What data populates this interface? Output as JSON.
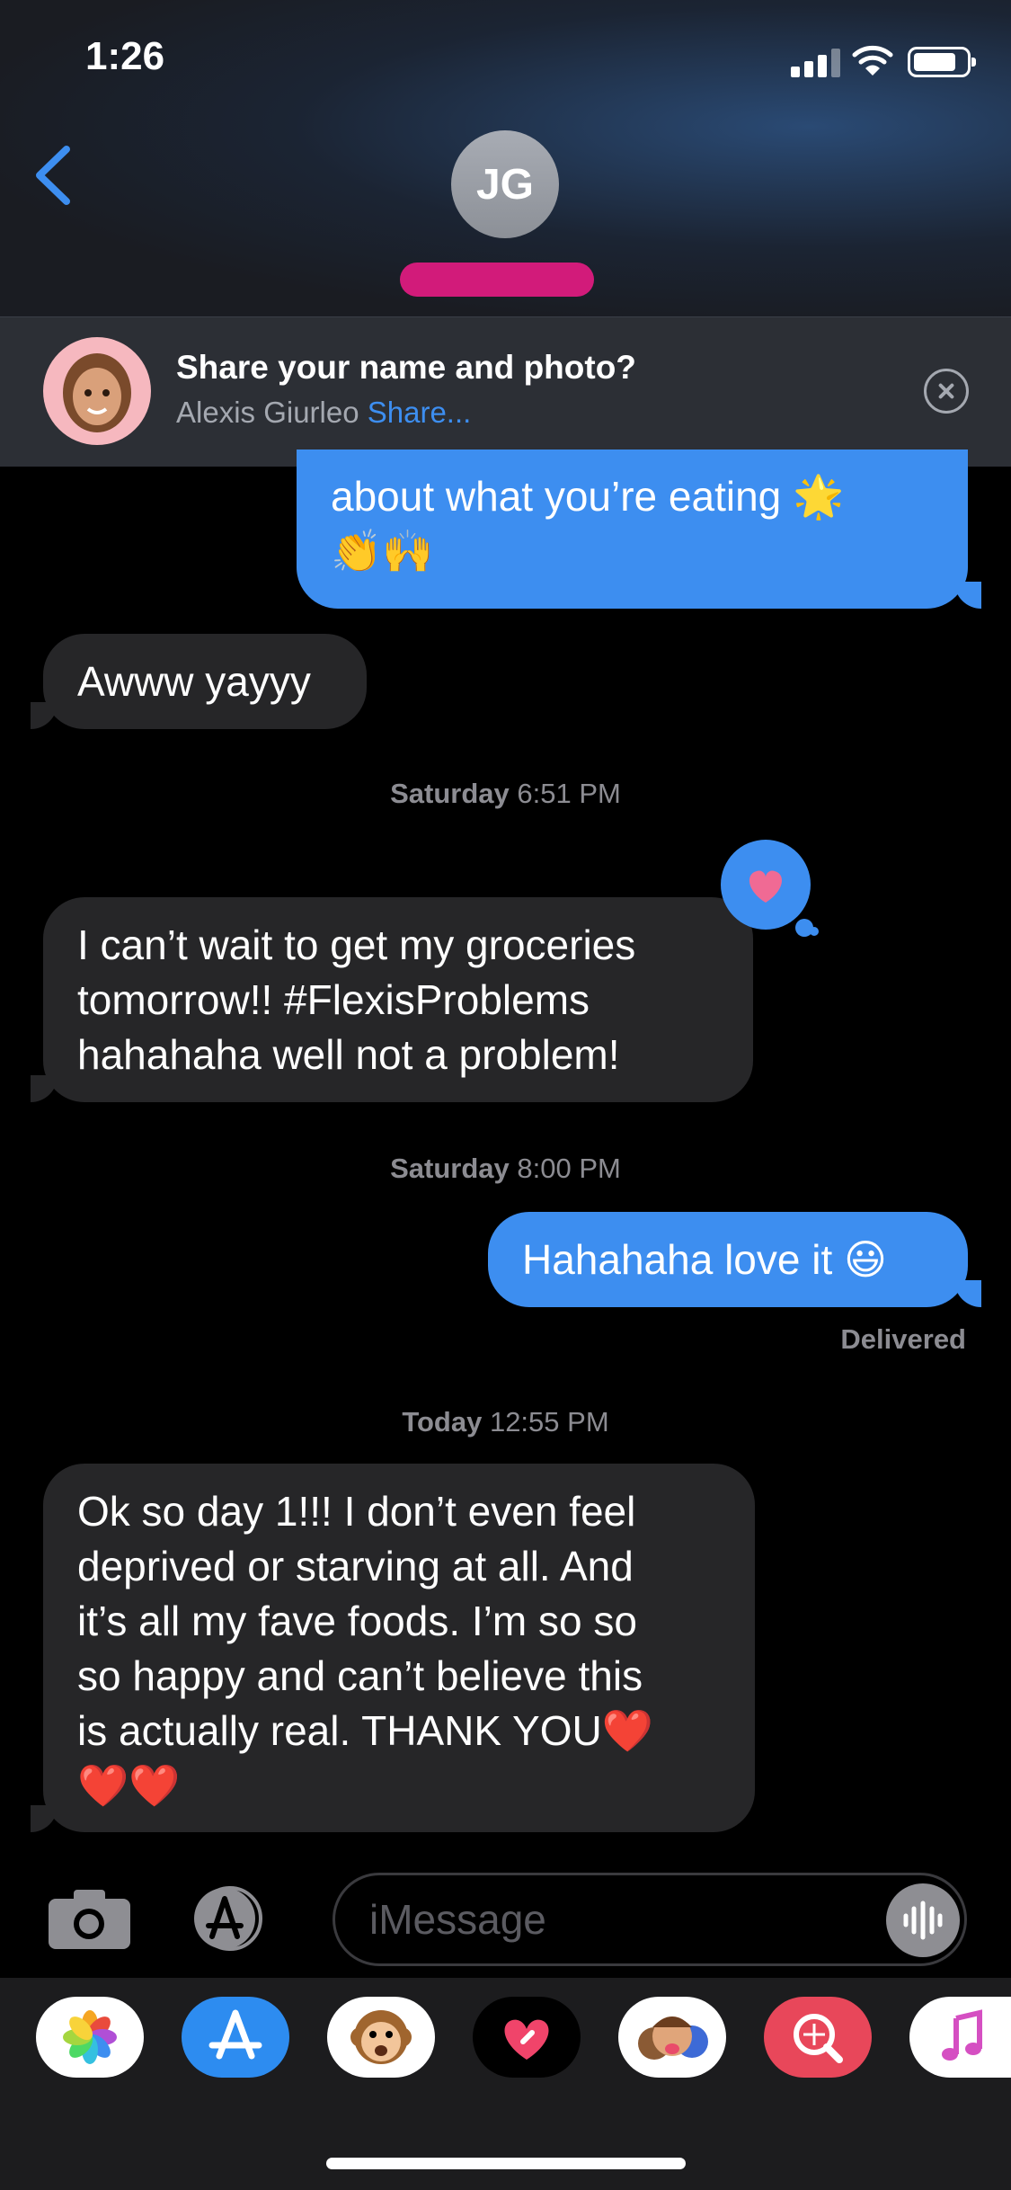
{
  "status_bar": {
    "time": "1:26"
  },
  "header": {
    "contact_initials": "JG"
  },
  "share_banner": {
    "title": "Share your name and photo?",
    "name": "Alexis Giurleo",
    "action": "Share..."
  },
  "messages": {
    "m1_line1": "about what you’re eating 🌟",
    "m1_line2": "👏🙌",
    "m2": "Awww yayyy",
    "stamp1_day": "Saturday",
    "stamp1_time": "6:51 PM",
    "m3_lines": [
      "I can’t wait to get my groceries",
      "tomorrow!! #FlexisProblems",
      "hahahaha well not a problem!"
    ],
    "stamp2_day": "Saturday",
    "stamp2_time": "8:00 PM",
    "m4": "Hahahaha love it 😃",
    "delivered": "Delivered",
    "stamp3_day": "Today",
    "stamp3_time": "12:55 PM",
    "m5_lines": [
      "Ok so day 1!!! I don’t even feel",
      "deprived or starving at all. And",
      "it’s all my fave foods. I’m so so",
      "so happy and can’t believe this",
      "is actually real. THANK YOU❤️",
      "❤️❤️"
    ]
  },
  "composer": {
    "placeholder": "iMessage"
  },
  "app_drawer": [
    "photos-app-icon",
    "app-store-icon",
    "animoji-icon",
    "digital-touch-icon",
    "memoji-stickers-icon",
    "images-search-icon",
    "music-app-icon"
  ],
  "colors": {
    "accent": "#3d8ef0",
    "incoming": "#262628",
    "redaction": "#d21b7a"
  }
}
